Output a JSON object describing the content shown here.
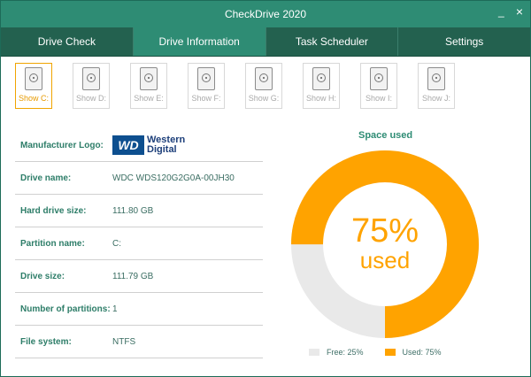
{
  "window": {
    "title": "CheckDrive 2020",
    "minimize_label": "_",
    "close_label": "×"
  },
  "tabs": [
    {
      "label": "Drive Check"
    },
    {
      "label": "Drive Information"
    },
    {
      "label": "Task Scheduler"
    },
    {
      "label": "Settings"
    }
  ],
  "drives": [
    {
      "label": "Show C:"
    },
    {
      "label": "Show D:"
    },
    {
      "label": "Show E:"
    },
    {
      "label": "Show F:"
    },
    {
      "label": "Show G:"
    },
    {
      "label": "Show H:"
    },
    {
      "label": "Show I:"
    },
    {
      "label": "Show J:"
    }
  ],
  "info": {
    "manufacturer_logo_label": "Manufacturer Logo:",
    "logo_mark": "WD",
    "logo_line1": "Western",
    "logo_line2": "Digital",
    "drive_name_label": "Drive name:",
    "drive_name": "WDC WDS120G2G0A-00JH30",
    "hard_drive_size_label": "Hard drive size:",
    "hard_drive_size": "111.80 GB",
    "partition_name_label": "Partition name:",
    "partition_name": "C:",
    "drive_size_label": "Drive size:",
    "drive_size": "111.79 GB",
    "partitions_label": "Number of partitions:",
    "partitions": "1",
    "file_system_label": "File system:",
    "file_system": "NTFS"
  },
  "space": {
    "title": "Space used",
    "percent_text": "75%",
    "used_word": "used",
    "used_fraction": 0.75,
    "free_label": "Free: 25%",
    "used_label": "Used: 75%",
    "used_color": "#ffa300",
    "free_color": "#e9e9e9"
  }
}
